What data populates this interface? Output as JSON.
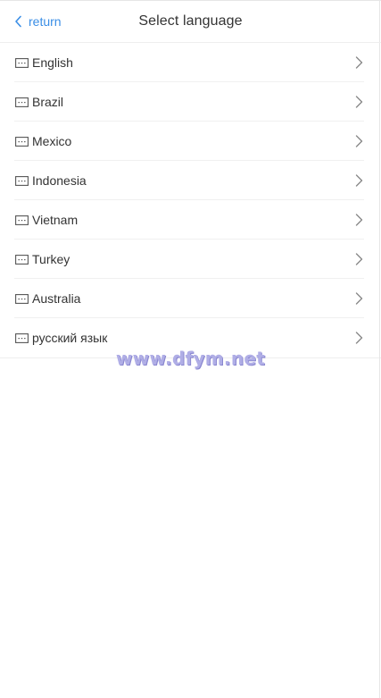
{
  "header": {
    "back_label": "return",
    "title": "Select language"
  },
  "languages": [
    {
      "label": "English"
    },
    {
      "label": "Brazil"
    },
    {
      "label": "Mexico"
    },
    {
      "label": "Indonesia"
    },
    {
      "label": "Vietnam"
    },
    {
      "label": "Turkey"
    },
    {
      "label": "Australia"
    },
    {
      "label": "русский язык"
    }
  ],
  "watermark": "www.dfym.net",
  "icons": {
    "back": "chevron-left-icon",
    "language": "keyboard-icon",
    "row_arrow": "chevron-right-icon"
  },
  "colors": {
    "accent": "#3a8ee6",
    "text": "#333333",
    "chevron": "#888888",
    "divider": "#f0f0f0",
    "watermark": "#b0aee6"
  }
}
